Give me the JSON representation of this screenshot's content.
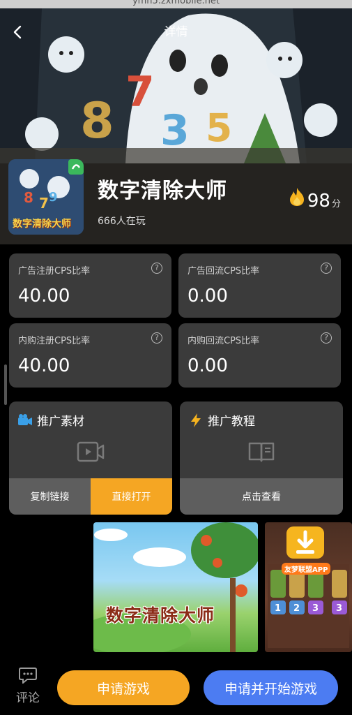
{
  "browser": {
    "url": "ymh5.zxmobile.net"
  },
  "header": {
    "title": "详情"
  },
  "game": {
    "name": "数字清除大师",
    "players": "666人在玩",
    "score": "98",
    "score_unit": "分",
    "icon_text": "数字清除大师"
  },
  "rates": [
    {
      "label": "广告注册CPS比率",
      "value": "40.00"
    },
    {
      "label": "广告回流CPS比率",
      "value": "0.00"
    },
    {
      "label": "内购注册CPS比率",
      "value": "40.00"
    },
    {
      "label": "内购回流CPS比率",
      "value": "0.00"
    }
  ],
  "help_glyph": "?",
  "promo_material": {
    "title": "推广素材",
    "copy_label": "复制链接",
    "open_label": "直接打开"
  },
  "promo_tutorial": {
    "title": "推广教程",
    "view_label": "点击查看"
  },
  "screenshots": {
    "shot1_title": "数字清除大师",
    "download_badge": "友梦联盟APP"
  },
  "bottom": {
    "comment_label": "评论",
    "apply_label": "申请游戏",
    "apply_start_label": "申请并开始游戏"
  },
  "colors": {
    "accent_orange": "#f5a623",
    "accent_blue": "#4c7cf2",
    "card_bg": "#3b3b3b"
  }
}
